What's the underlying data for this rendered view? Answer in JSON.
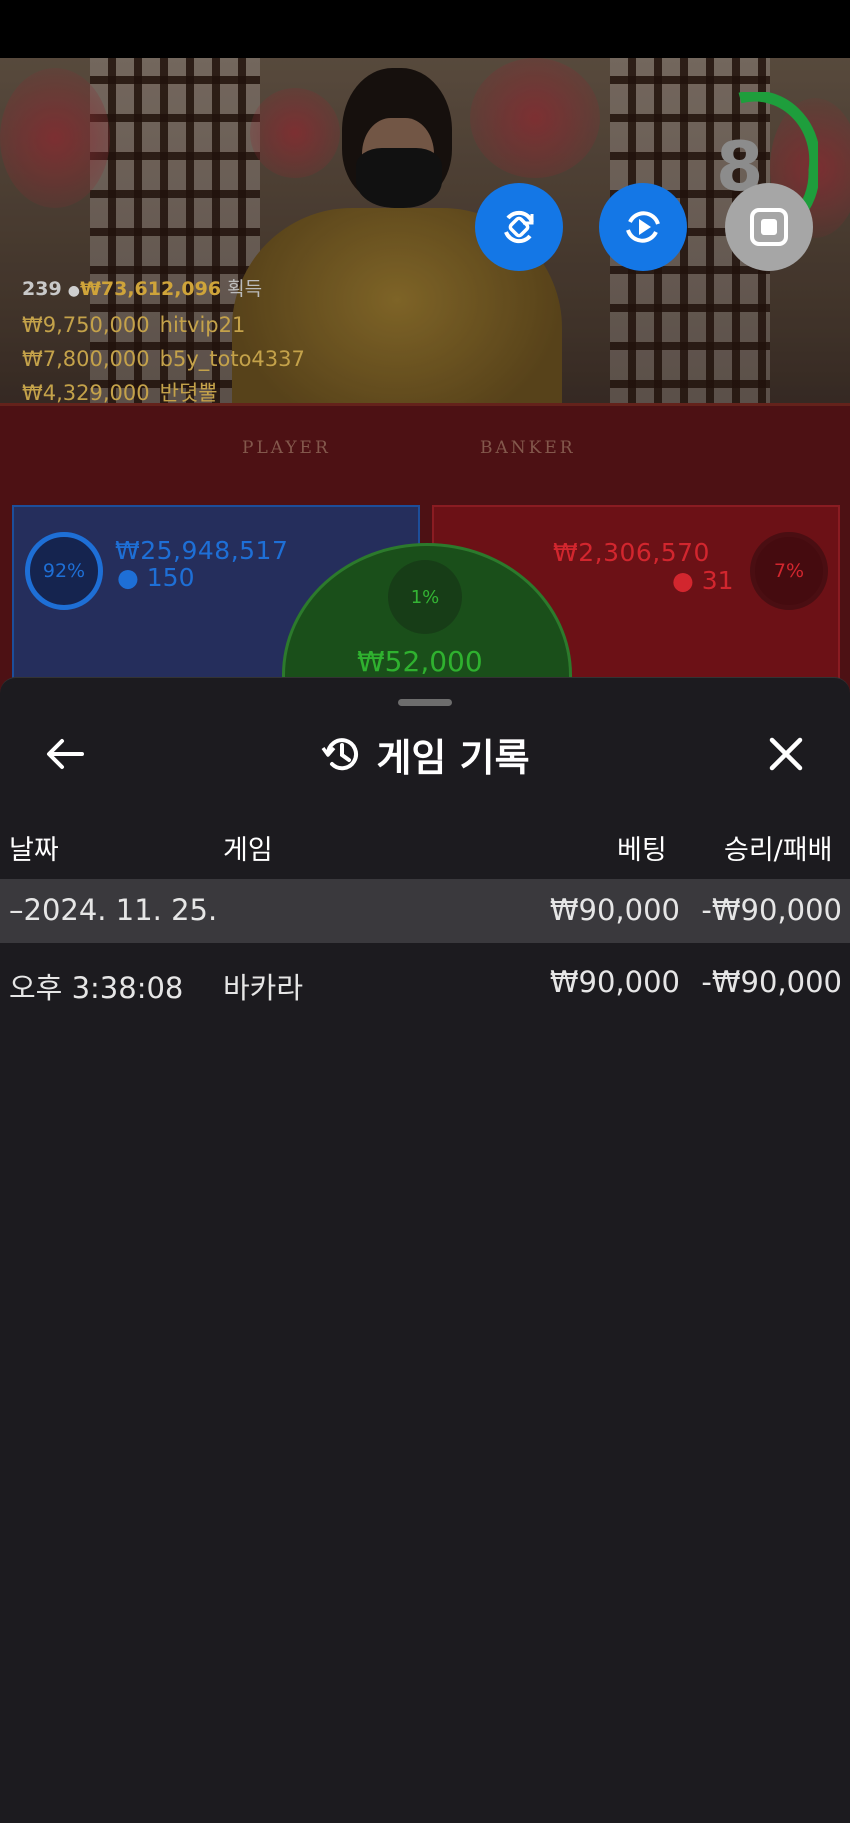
{
  "stream_overlay": {
    "player_count": "239",
    "total_winnings": "₩73,612,096",
    "winnings_suffix": "획득",
    "top_winners": [
      {
        "amount": "₩9,750,000",
        "name": "hitvip21"
      },
      {
        "amount": "₩7,800,000",
        "name": "b5y_toto4337"
      },
      {
        "amount": "₩4,329,000",
        "name": "반뎟뿔"
      }
    ],
    "table_labels": {
      "player": "PLAYER",
      "banker": "BANKER"
    },
    "timer": "8"
  },
  "bets": {
    "player": {
      "percent": "92%",
      "amount": "₩25,948,517",
      "players": "150",
      "color": "#1e6fd6"
    },
    "tie": {
      "percent": "1%",
      "amount": "₩52,000",
      "color": "#2fb12f"
    },
    "banker": {
      "percent": "7%",
      "amount": "₩2,306,570",
      "players": "31",
      "color": "#d2262e"
    }
  },
  "game_history": {
    "title": "게임 기록",
    "columns": {
      "date": "날짜",
      "game": "게임",
      "bet": "베팅",
      "win_loss": "승리/패배"
    },
    "date_group": {
      "label": "–2024. 11. 25.",
      "bet": "₩90,000",
      "win_loss": "-₩90,000"
    },
    "rows": [
      {
        "time": "오후 3:38:08",
        "game": "바카라",
        "bet": "₩90,000",
        "win_loss": "-₩90,000"
      }
    ]
  },
  "colors": {
    "accent_blue": "#1477e6",
    "sheet_bg": "#1c1b1f",
    "row_highlight": "#3a393d"
  }
}
